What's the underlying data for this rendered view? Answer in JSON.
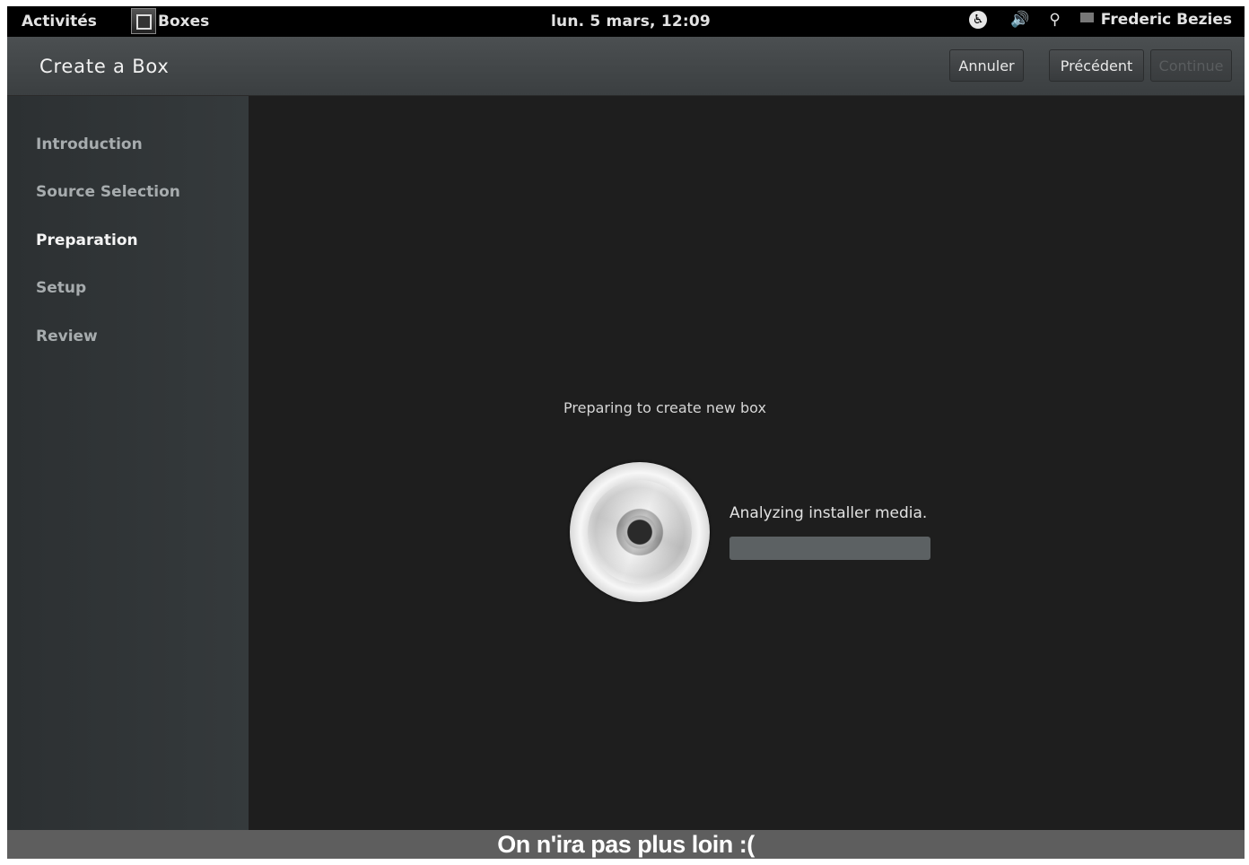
{
  "topbar": {
    "activities": "Activités",
    "app_name": "Boxes",
    "clock": "lun.  5 mars, 12:09",
    "user": "Frederic Bezies",
    "icons": [
      "accessibility-icon",
      "volume-icon",
      "network-icon",
      "user-icon"
    ]
  },
  "header": {
    "title": "Create a Box",
    "cancel_label": "Annuler",
    "prev_label": "Précédent",
    "next_label": "Continue"
  },
  "sidebar": {
    "steps": [
      {
        "label": "Introduction",
        "active": false
      },
      {
        "label": "Source Selection",
        "active": false
      },
      {
        "label": "Preparation",
        "active": true
      },
      {
        "label": "Setup",
        "active": false
      },
      {
        "label": "Review",
        "active": false
      }
    ]
  },
  "main": {
    "title": "Preparing to create new box",
    "status": "Analyzing installer media.",
    "progress": 0,
    "media_icon": "disc-icon"
  },
  "caption": "On n'ira pas plus loin :("
}
